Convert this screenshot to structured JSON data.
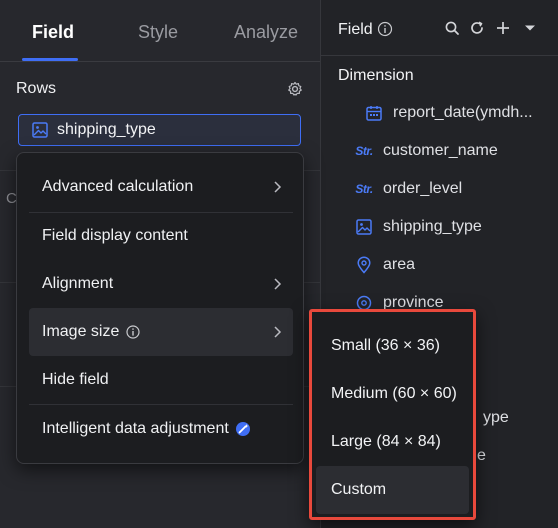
{
  "left_panel": {
    "tabs": [
      {
        "label": "Field",
        "active": true
      },
      {
        "label": "Style",
        "active": false
      },
      {
        "label": "Analyze",
        "active": false
      }
    ],
    "rows_title": "Rows",
    "field_chip": {
      "label": "shipping_type",
      "icon": "image-icon"
    }
  },
  "context_menu": {
    "items": [
      {
        "label": "Advanced calculation",
        "has_submenu": true
      },
      {
        "label": "Field display content",
        "has_submenu": false
      },
      {
        "label": "Alignment",
        "has_submenu": true
      },
      {
        "label": "Image size",
        "has_submenu": true,
        "info_icon": true,
        "hovered": true
      },
      {
        "label": "Hide field",
        "has_submenu": false
      },
      {
        "label": "Intelligent data adjustment",
        "has_submenu": false,
        "badge_icon": "magic-icon"
      }
    ]
  },
  "image_size_submenu": {
    "items": [
      {
        "label": "Small (36 × 36)"
      },
      {
        "label": "Medium (60 × 60)"
      },
      {
        "label": "Large (84 × 84)"
      },
      {
        "label": "Custom",
        "hovered": true
      }
    ],
    "highlight_color": "#e8493c"
  },
  "right_panel": {
    "title": "Field",
    "dimension_title": "Dimension",
    "dimensions": [
      {
        "label": "report_date(ymdh...",
        "icon": "calendar-icon"
      },
      {
        "label": "customer_name",
        "icon": "str-icon"
      },
      {
        "label": "order_level",
        "icon": "str-icon"
      },
      {
        "label": "shipping_type",
        "icon": "image-icon"
      },
      {
        "label": "area",
        "icon": "location-icon"
      },
      {
        "label": "province",
        "icon": "location-icon"
      }
    ],
    "partial_items": [
      "ype",
      "e"
    ]
  },
  "colors": {
    "accent": "#3f6ef5",
    "background": "#25262b",
    "menu_bg": "#1c1d20"
  }
}
